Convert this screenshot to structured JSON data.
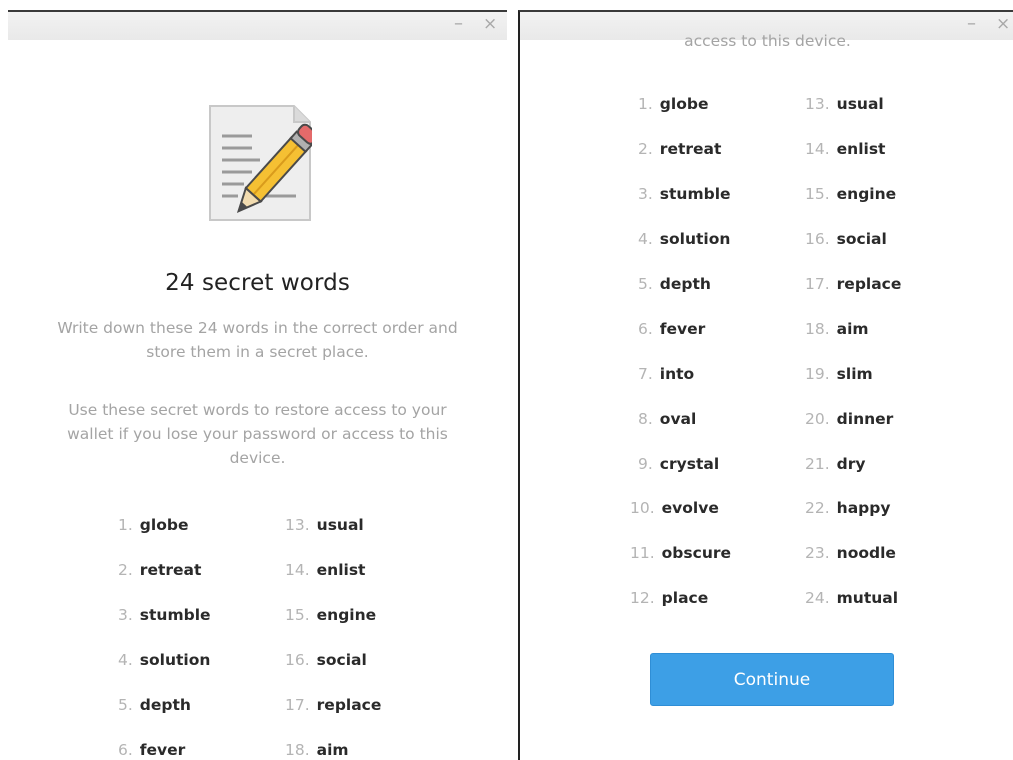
{
  "window_controls": {
    "minimize": "–",
    "close": "×"
  },
  "left_window": {
    "title": "24 secret words",
    "paragraph1": "Write down these 24 words in the correct order and store them in a secret place.",
    "paragraph2": "Use these secret words to restore access to your wallet if you lose your password or access to this device.",
    "col1": [
      {
        "num": "1.",
        "word": "globe"
      },
      {
        "num": "2.",
        "word": "retreat"
      },
      {
        "num": "3.",
        "word": "stumble"
      },
      {
        "num": "4.",
        "word": "solution"
      },
      {
        "num": "5.",
        "word": "depth"
      },
      {
        "num": "6.",
        "word": "fever"
      }
    ],
    "col2": [
      {
        "num": "13.",
        "word": "usual"
      },
      {
        "num": "14.",
        "word": "enlist"
      },
      {
        "num": "15.",
        "word": "engine"
      },
      {
        "num": "16.",
        "word": "social"
      },
      {
        "num": "17.",
        "word": "replace"
      },
      {
        "num": "18.",
        "word": "aim"
      }
    ]
  },
  "right_window": {
    "cut_text": "access to this device.",
    "col1": [
      {
        "num": "1.",
        "word": "globe"
      },
      {
        "num": "2.",
        "word": "retreat"
      },
      {
        "num": "3.",
        "word": "stumble"
      },
      {
        "num": "4.",
        "word": "solution"
      },
      {
        "num": "5.",
        "word": "depth"
      },
      {
        "num": "6.",
        "word": "fever"
      },
      {
        "num": "7.",
        "word": "into"
      },
      {
        "num": "8.",
        "word": "oval"
      },
      {
        "num": "9.",
        "word": "crystal"
      },
      {
        "num": "10.",
        "word": "evolve"
      },
      {
        "num": "11.",
        "word": "obscure"
      },
      {
        "num": "12.",
        "word": "place"
      }
    ],
    "col2": [
      {
        "num": "13.",
        "word": "usual"
      },
      {
        "num": "14.",
        "word": "enlist"
      },
      {
        "num": "15.",
        "word": "engine"
      },
      {
        "num": "16.",
        "word": "social"
      },
      {
        "num": "17.",
        "word": "replace"
      },
      {
        "num": "18.",
        "word": "aim"
      },
      {
        "num": "19.",
        "word": "slim"
      },
      {
        "num": "20.",
        "word": "dinner"
      },
      {
        "num": "21.",
        "word": "dry"
      },
      {
        "num": "22.",
        "word": "happy"
      },
      {
        "num": "23.",
        "word": "noodle"
      },
      {
        "num": "24.",
        "word": "mutual"
      }
    ],
    "continue_label": "Continue"
  },
  "colors": {
    "accent": "#3d9fe6",
    "muted_text": "#a4a4a4",
    "word_text": "#2a2a2a"
  },
  "icons": [
    "document-pencil-icon",
    "minimize-icon",
    "close-icon"
  ]
}
